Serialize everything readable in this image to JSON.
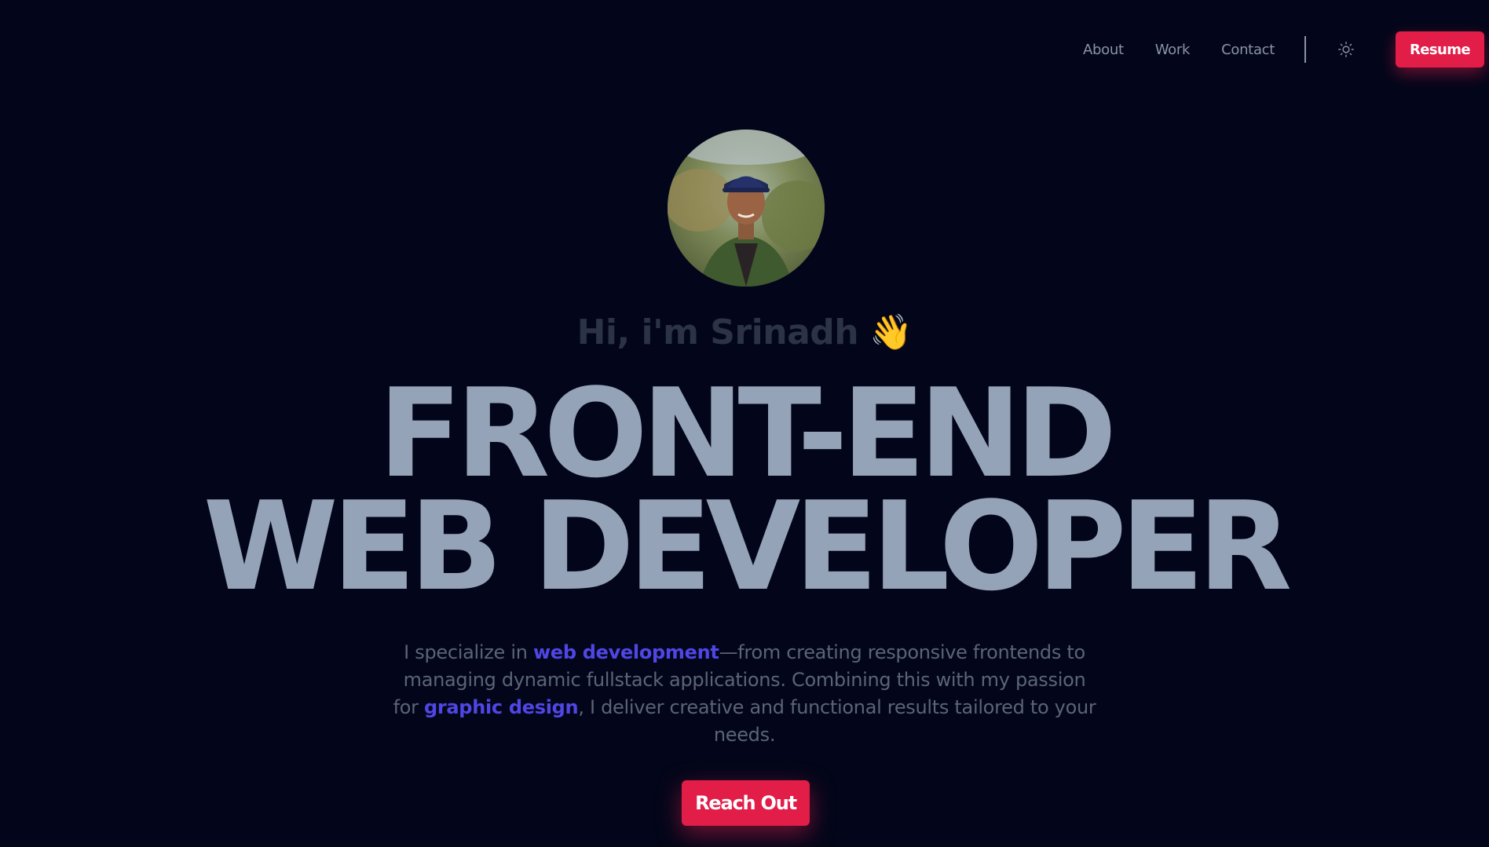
{
  "nav": {
    "links": [
      "About",
      "Work",
      "Contact"
    ],
    "theme_toggle_icon": "sun-icon",
    "resume_label": "Resume"
  },
  "hero": {
    "greeting": "Hi, i'm Srinadh",
    "wave_emoji": "👋",
    "headline_line1": "FRONT-END",
    "headline_line2": "WEB DEVELOPER",
    "description": {
      "part1": "I specialize in ",
      "highlight1": "web development",
      "part2": "—from creating responsive frontends to managing dynamic fullstack applications. Combining this with my passion for ",
      "highlight2": "graphic design",
      "part3": ", I deliver creative and functional results tailored to your needs."
    },
    "cta_label": "Reach Out"
  },
  "colors": {
    "background": "#03061a",
    "accent": "#e11d48",
    "highlight": "#4f46e5",
    "headline": "#94a3b8"
  }
}
